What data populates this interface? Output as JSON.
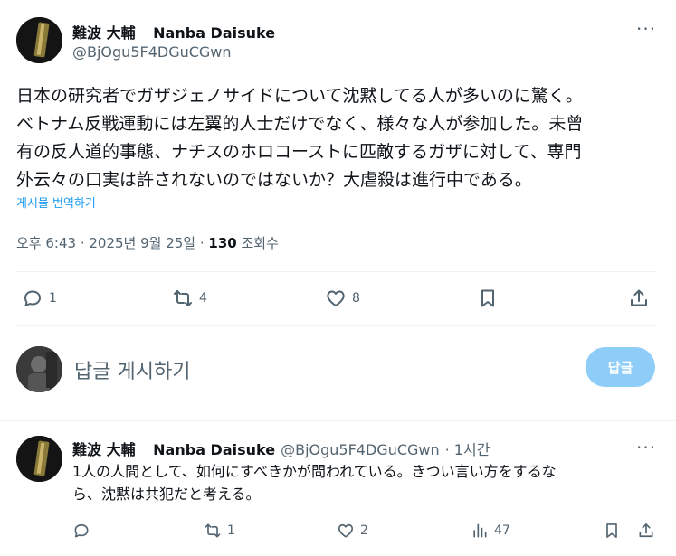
{
  "tweet": {
    "display_name": "難波 大輔",
    "display_name_en": "Nanba Daisuke",
    "handle": "@BjOgu5F4DGuCGwn",
    "text_lines": [
      "日本の研究者でガザジェノサイドについて沈黙してる人が多いのに驚く。",
      "ベトナム反戦運動には左翼的人士だけでなく、様々な人が参加した。未曾",
      "有の反人道的事態、ナチスのホロコーストに匹敵するガザに対して、専門",
      "外云々の口実は許されないのではないか？大虐殺は進行中である。"
    ],
    "translate_label": "게시물 번역하기",
    "time": "오후 6:43 · 2025년 9월 25일 · ",
    "views_count": "130",
    "views_label": " 조회수",
    "stats": {
      "replies": "1",
      "retweets": "4",
      "likes": "8"
    }
  },
  "compose": {
    "placeholder": "답글 게시하기",
    "button_label": "답글"
  },
  "reply": {
    "display_name": "難波 大輔",
    "display_name_en": "Nanba Daisuke",
    "handle": "@BjOgu5F4DGuCGwn",
    "time": "· 1시간",
    "text_lines": [
      "1人の人間として、如何にすべきかが問われている。きつい言い方をするな",
      "ら、沈黙は共犯だと考える。"
    ],
    "stats": {
      "retweets": "1",
      "likes": "2",
      "views": "47"
    }
  },
  "more_label": "···",
  "colors": {
    "accent": "#1d9bf0",
    "reply_button": "#8ecdf8",
    "secondary_text": "#536471",
    "divider": "#eff3f4"
  }
}
